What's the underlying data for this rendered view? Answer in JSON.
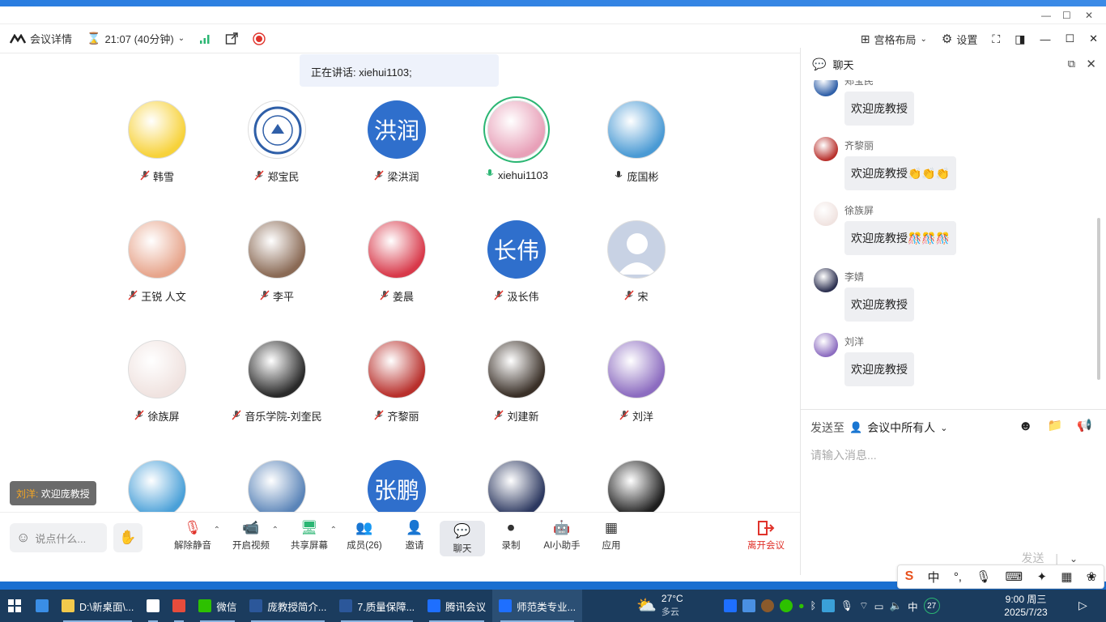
{
  "topbar": {
    "meeting_details": "会议详情",
    "timer": "21:07 (40分钟)",
    "layout": "宫格布局",
    "settings": "设置"
  },
  "speaking": "正在讲话: xiehui1103;",
  "participants": [
    {
      "name": "韩雪",
      "mic": "off",
      "avatar": "photo",
      "color": "#f7d23a"
    },
    {
      "name": "郑宝民",
      "mic": "off",
      "avatar": "logo",
      "color": "#2f5fa8"
    },
    {
      "name": "梁洪润",
      "mic": "off",
      "avatar": "text",
      "text": "洪润",
      "color": "#2f6fcc"
    },
    {
      "name": "xiehui1103",
      "mic": "on-active",
      "avatar": "photo",
      "color": "#e8a0b8"
    },
    {
      "name": "庞国彬",
      "mic": "on",
      "avatar": "photo",
      "color": "#4a9ad4"
    },
    {
      "name": "王锐 人文",
      "mic": "off",
      "avatar": "photo",
      "color": "#e7a58c"
    },
    {
      "name": "李平",
      "mic": "off",
      "avatar": "photo",
      "color": "#8a6a55"
    },
    {
      "name": "姜晨",
      "mic": "off",
      "avatar": "photo",
      "color": "#d8394a"
    },
    {
      "name": "汲长伟",
      "mic": "off",
      "avatar": "text",
      "text": "长伟",
      "color": "#2f6fcc"
    },
    {
      "name": "宋",
      "mic": "off",
      "avatar": "default",
      "color": "#c8d2e4"
    },
    {
      "name": "徐族屏",
      "mic": "off",
      "avatar": "photo",
      "color": "#f0e3e0"
    },
    {
      "name": "音乐学院-刘奎民",
      "mic": "off",
      "avatar": "photo",
      "color": "#2a2a2a"
    },
    {
      "name": "齐黎丽",
      "mic": "off",
      "avatar": "photo",
      "color": "#b8302c"
    },
    {
      "name": "刘建新",
      "mic": "off",
      "avatar": "photo",
      "color": "#3a3028"
    },
    {
      "name": "刘洋",
      "mic": "off",
      "avatar": "photo",
      "color": "#8c6cc0"
    },
    {
      "name": "",
      "mic": "",
      "avatar": "photo",
      "color": "#4aa0d8"
    },
    {
      "name": "",
      "mic": "",
      "avatar": "photo",
      "color": "#5a84b8"
    },
    {
      "name": "",
      "mic": "",
      "avatar": "text",
      "text": "张鹏",
      "color": "#2f6fcc"
    },
    {
      "name": "",
      "mic": "",
      "avatar": "photo",
      "color": "#2c3860"
    },
    {
      "name": "",
      "mic": "",
      "avatar": "photo",
      "color": "#1e1e1e"
    }
  ],
  "floating_msg": {
    "sender": "刘洋:",
    "text": "欢迎庞教授"
  },
  "bottom": {
    "say_placeholder": "说点什么...",
    "tools": [
      "解除静音",
      "开启视频",
      "共享屏幕",
      "成员(26)",
      "邀请",
      "聊天",
      "录制",
      "AI小助手",
      "应用"
    ],
    "leave": "离开会议"
  },
  "chat": {
    "title": "聊天",
    "messages": [
      {
        "sender": "郑宝民",
        "text": "欢迎庞教授",
        "color": "#2f5fa8"
      },
      {
        "sender": "齐黎丽",
        "text": "欢迎庞教授👏👏👏",
        "color": "#b8302c"
      },
      {
        "sender": "徐族屏",
        "text": "欢迎庞教授🎊🎊🎊",
        "color": "#f0e3e0"
      },
      {
        "sender": "李婧",
        "text": "欢迎庞教授",
        "color": "#2c3050"
      },
      {
        "sender": "刘洋",
        "text": "欢迎庞教授",
        "color": "#8c6cc0"
      }
    ],
    "send_to_label": "发送至",
    "send_to_target": "会议中所有人",
    "input_placeholder": "请输入消息...",
    "send": "发送"
  },
  "ime": {
    "mode": "中"
  },
  "taskbar": {
    "apps": [
      {
        "label": "D:\\新桌面\\...",
        "color": "#f2c94c"
      },
      {
        "label": "",
        "color": "#ffffff"
      },
      {
        "label": "",
        "color": "#e74c3c"
      },
      {
        "label": "微信",
        "color": "#2dc100"
      },
      {
        "label": "庞教授简介...",
        "color": "#2b579a"
      },
      {
        "label": "7.质量保障...",
        "color": "#2b579a"
      },
      {
        "label": "腾讯会议",
        "color": "#1e6fff"
      },
      {
        "label": "师范类专业...",
        "color": "#1e6fff"
      }
    ],
    "temp": "27°C",
    "weather": "多云",
    "ime": "中",
    "badge": "27",
    "time": "9:00 周三",
    "date": "2025/7/23"
  }
}
